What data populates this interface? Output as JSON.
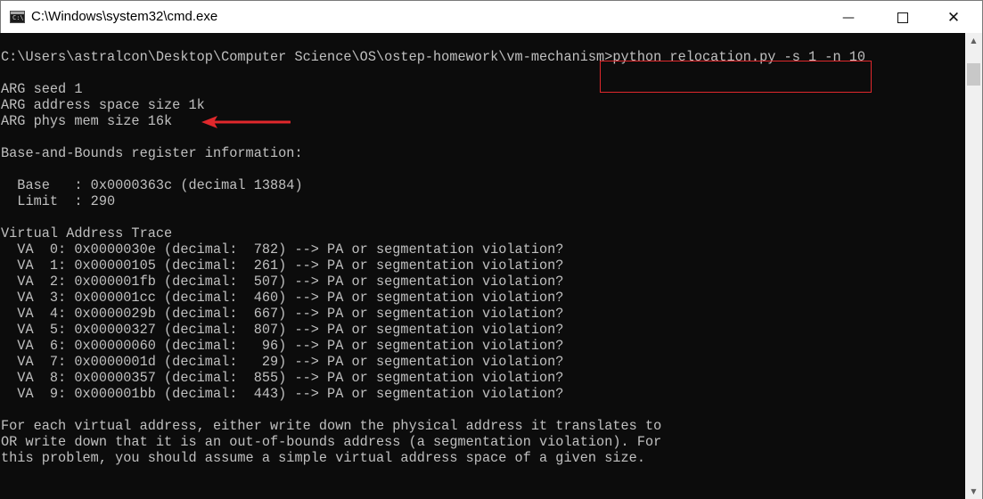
{
  "window": {
    "title": "C:\\Windows\\system32\\cmd.exe",
    "icon": "cmd-app-icon",
    "controls": {
      "minimize": "—",
      "close": "✕"
    }
  },
  "terminal": {
    "lines": [
      "",
      "C:\\Users\\astralcon\\Desktop\\Computer Science\\OS\\ostep-homework\\vm-mechanism>python relocation.py -s 1 -n 10",
      "",
      "ARG seed 1",
      "ARG address space size 1k",
      "ARG phys mem size 16k",
      "",
      "Base-and-Bounds register information:",
      "",
      "  Base   : 0x0000363c (decimal 13884)",
      "  Limit  : 290",
      "",
      "Virtual Address Trace",
      "  VA  0: 0x0000030e (decimal:  782) --> PA or segmentation violation?",
      "  VA  1: 0x00000105 (decimal:  261) --> PA or segmentation violation?",
      "  VA  2: 0x000001fb (decimal:  507) --> PA or segmentation violation?",
      "  VA  3: 0x000001cc (decimal:  460) --> PA or segmentation violation?",
      "  VA  4: 0x0000029b (decimal:  667) --> PA or segmentation violation?",
      "  VA  5: 0x00000327 (decimal:  807) --> PA or segmentation violation?",
      "  VA  6: 0x00000060 (decimal:   96) --> PA or segmentation violation?",
      "  VA  7: 0x0000001d (decimal:   29) --> PA or segmentation violation?",
      "  VA  8: 0x00000357 (decimal:  855) --> PA or segmentation violation?",
      "  VA  9: 0x000001bb (decimal:  443) --> PA or segmentation violation?",
      "",
      "For each virtual address, either write down the physical address it translates to",
      "OR write down that it is an out-of-bounds address (a segmentation violation). For",
      "this problem, you should assume a simple virtual address space of a given size."
    ]
  },
  "annotations": {
    "highlight_color": "#e0282c",
    "arrow_icon": "left-arrow-icon"
  },
  "colors": {
    "console_bg": "#0c0c0c",
    "console_fg": "#c0c0c0",
    "titlebar_bg": "#ffffff"
  }
}
